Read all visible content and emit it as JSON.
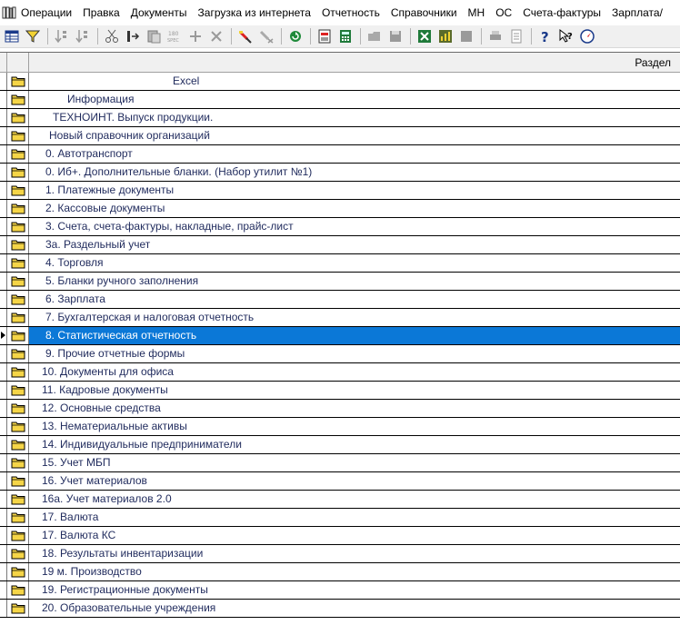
{
  "menubar": {
    "app_icon": "books-icon",
    "items": [
      "Операции",
      "Правка",
      "Документы",
      "Загрузка из интернета",
      "Отчетность",
      "Справочники",
      "МН",
      "ОС",
      "Счета-фактуры",
      "Зарплата/"
    ]
  },
  "toolbar": {
    "buttons": [
      "table-view-icon",
      "filter-icon",
      "sep",
      "sort-asc-icon",
      "sort-desc-icon",
      "sep",
      "cut-icon",
      "move-icon",
      "paste-icon",
      "rotate-180-icon",
      "add-icon",
      "delete-icon",
      "sep",
      "mark-icon",
      "clear-mark-icon",
      "sep",
      "refresh-icon",
      "sep",
      "pdf-doc-icon",
      "calculator-icon",
      "sep",
      "open-folder-icon",
      "save-icon",
      "sep",
      "excel-icon",
      "chart-icon",
      "archive-icon",
      "sep",
      "print-icon",
      "preview-icon",
      "sep",
      "help-icon",
      "context-help-icon",
      "compass-icon"
    ]
  },
  "grid": {
    "header": "Раздел",
    "selected_index": 14,
    "rows": [
      {
        "label": "Excel",
        "indent": 190
      },
      {
        "label": "Информация",
        "indent": 74
      },
      {
        "label": "ТЕХНОИНТ. Выпуск продукции.",
        "indent": 58
      },
      {
        "label": "Новый справочник организаций",
        "indent": 54
      },
      {
        "label": "0. Автотранспорт",
        "indent": 50
      },
      {
        "label": "0. Иб+. Дополнительные бланки. (Набор утилит №1)",
        "indent": 50
      },
      {
        "label": "1. Платежные документы",
        "indent": 50
      },
      {
        "label": "2. Кассовые документы",
        "indent": 50
      },
      {
        "label": "3. Счета, счета-фактуры, накладные, прайс-лист",
        "indent": 50
      },
      {
        "label": "3а. Раздельный учет",
        "indent": 50
      },
      {
        "label": "4. Торговля",
        "indent": 50
      },
      {
        "label": "5. Бланки ручного заполнения",
        "indent": 50
      },
      {
        "label": "6. Зарплата",
        "indent": 50
      },
      {
        "label": "7. Бухгалтерская и налоговая отчетность",
        "indent": 50
      },
      {
        "label": "8. Статистическая отчетность",
        "indent": 50
      },
      {
        "label": "9. Прочие отчетные формы",
        "indent": 50
      },
      {
        "label": "10. Документы для офиса",
        "indent": 46
      },
      {
        "label": "11. Кадровые документы",
        "indent": 46
      },
      {
        "label": "12. Основные средства",
        "indent": 46
      },
      {
        "label": "13. Нематериальные активы",
        "indent": 46
      },
      {
        "label": "14. Индивидуальные предприниматели",
        "indent": 46
      },
      {
        "label": "15. Учет МБП",
        "indent": 46
      },
      {
        "label": "16. Учет материалов",
        "indent": 46
      },
      {
        "label": "16а. Учет материалов 2.0",
        "indent": 46
      },
      {
        "label": "17. Валюта",
        "indent": 46
      },
      {
        "label": "17. Валюта КС",
        "indent": 46
      },
      {
        "label": "18. Результаты инвентаризации",
        "indent": 46
      },
      {
        "label": "19 м. Производство",
        "indent": 46
      },
      {
        "label": "19. Регистрационные документы",
        "indent": 46
      },
      {
        "label": "20. Образовательные учреждения",
        "indent": 46
      }
    ]
  },
  "colors": {
    "selection": "#0b78d7",
    "row_text": "#1f2a5c",
    "folder": "#f5d547"
  }
}
